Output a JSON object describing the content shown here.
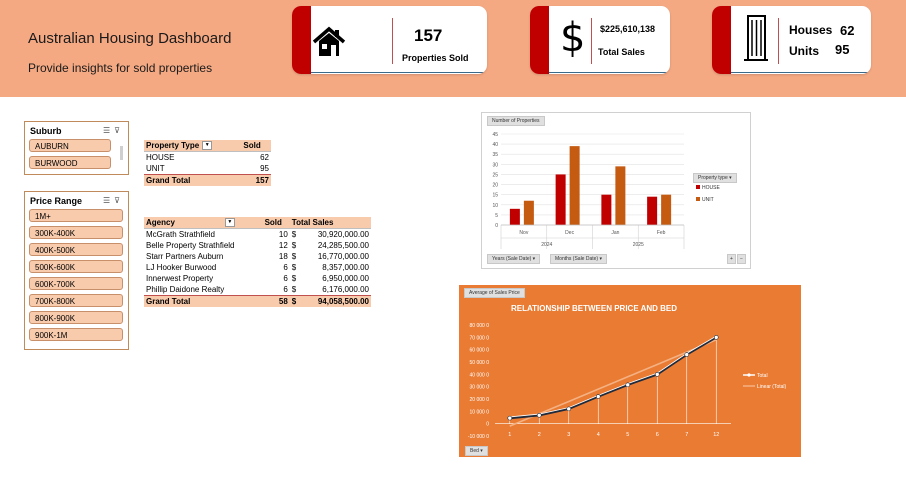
{
  "header": {
    "title": "Australian Housing Dashboard",
    "subtitle": "Provide insights for sold properties"
  },
  "kpis": {
    "properties": {
      "icon": "house-icon",
      "value": "157",
      "label": "Properties Sold"
    },
    "sales": {
      "icon": "dollar-icon",
      "value": "$225,610,138",
      "label": "Total Sales"
    },
    "types": {
      "icon": "building-icon",
      "houses_label": "Houses",
      "houses_value": "62",
      "units_label": "Units",
      "units_value": "95"
    }
  },
  "colors": {
    "banner": "#f4a983",
    "accent": "#c00000",
    "house_bar": "#c00000",
    "unit_bar": "#c55a11",
    "chart_bg": "#e97b33"
  },
  "suburb_slicer": {
    "title": "Suburb",
    "items": [
      "AUBURN",
      "BURWOOD"
    ]
  },
  "price_slicer": {
    "title": "Price Range",
    "items": [
      "1M+",
      "300K-400K",
      "400K-500K",
      "500K-600K",
      "600K-700K",
      "700K-800K",
      "800K-900K",
      "900K-1M"
    ]
  },
  "property_table": {
    "headers": [
      "Property Type",
      "Sold"
    ],
    "rows": [
      [
        "HOUSE",
        "62"
      ],
      [
        "UNIT",
        "95"
      ]
    ],
    "total": [
      "Grand Total",
      "157"
    ]
  },
  "agency_table": {
    "headers": [
      "Agency",
      "Sold",
      "Total Sales"
    ],
    "rows": [
      [
        "McGrath Strathfield",
        "10",
        "$",
        "30,920,000.00"
      ],
      [
        "Belle Property Strathfield",
        "12",
        "$",
        "24,285,500.00"
      ],
      [
        "Starr Partners Auburn",
        "18",
        "$",
        "16,770,000.00"
      ],
      [
        "LJ Hooker Burwood",
        "6",
        "$",
        "8,357,000.00"
      ],
      [
        "Innerwest Property",
        "6",
        "$",
        "6,950,000.00"
      ],
      [
        "Phillip Daidone Realty",
        "6",
        "$",
        "6,176,000.00"
      ]
    ],
    "total": [
      "Grand Total",
      "58",
      "$",
      "94,058,500.00"
    ]
  },
  "chart_data": [
    {
      "type": "bar",
      "field_button": "Number of Properties",
      "categories": [
        "Nov",
        "Dec",
        "Jan",
        "Feb"
      ],
      "groups": [
        {
          "label": "2024",
          "span": 2
        },
        {
          "label": "2025",
          "span": 2
        }
      ],
      "series": [
        {
          "name": "HOUSE",
          "values": [
            8,
            25,
            15,
            14
          ]
        },
        {
          "name": "UNIT",
          "values": [
            12,
            39,
            29,
            15
          ]
        }
      ],
      "yticks": [
        "45",
        "40",
        "35",
        "30",
        "25",
        "20",
        "15",
        "10",
        "5",
        "0"
      ],
      "ylim": [
        0,
        45
      ],
      "legend_title": "Property type",
      "legend_position": "right",
      "axis_buttons": [
        "Years (Sale Date)",
        "Months (Sale Date)"
      ],
      "zoom_buttons": [
        "+",
        "−"
      ]
    },
    {
      "type": "line",
      "field_button": "Average of Sales Price",
      "title": "RELATIONSHIP BETWEEN PRICE AND BED",
      "categories": [
        "1",
        "2",
        "3",
        "4",
        "5",
        "6",
        "7",
        "12"
      ],
      "series": [
        {
          "name": "Total",
          "values": [
            4500000,
            6800000,
            12000000,
            22000000,
            31500000,
            40000000,
            56000000,
            70000000
          ]
        },
        {
          "name": "Linear (Total)",
          "values": [
            -2000000,
            8000000,
            18000000,
            28000000,
            38000000,
            48000000,
            58000000,
            68000000
          ]
        }
      ],
      "yticks": [
        "80 000 0",
        "70 000 0",
        "60 000 0",
        "50 000 0",
        "40 000 0",
        "30 000 0",
        "20 000 0",
        "10 000 0",
        "0",
        "-10 000 0"
      ],
      "ylim": [
        -10000000,
        80000000
      ],
      "legend_position": "right",
      "axis_button": "Bed"
    }
  ]
}
